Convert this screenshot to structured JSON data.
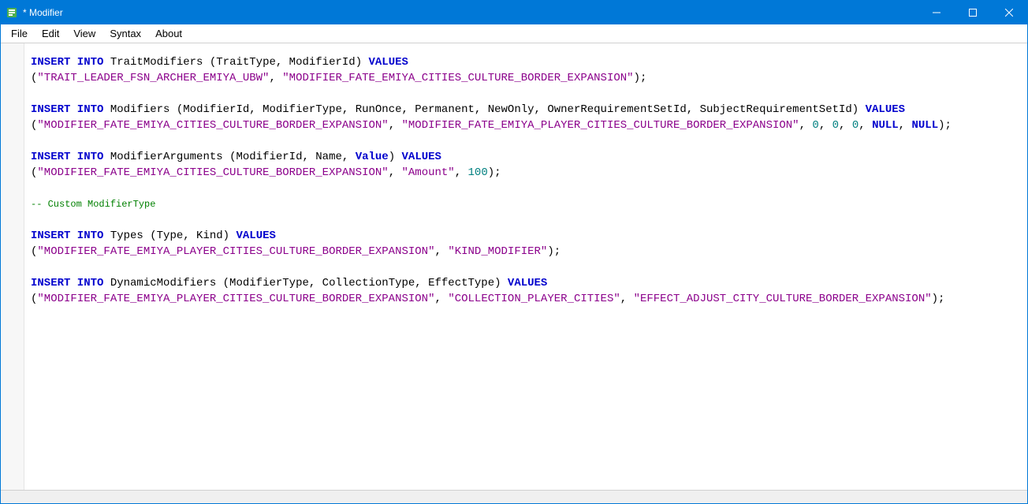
{
  "window": {
    "title": "* Modifier"
  },
  "menu": {
    "items": [
      "File",
      "Edit",
      "View",
      "Syntax",
      "About"
    ]
  },
  "sql": {
    "stmt1": {
      "kw1": "INSERT INTO",
      "tbl": "TraitModifiers",
      "cols": "(TraitType, ModifierId)",
      "kw2": "VALUES",
      "v1": "\"TRAIT_LEADER_FSN_ARCHER_EMIYA_UBW\"",
      "v2": "\"MODIFIER_FATE_EMIYA_CITIES_CULTURE_BORDER_EXPANSION\""
    },
    "stmt2": {
      "kw1": "INSERT INTO",
      "tbl": "Modifiers",
      "cols": "(ModifierId, ModifierType, RunOnce, Permanent, NewOnly, OwnerRequirementSetId, SubjectRequirementSetId)",
      "kw2": "VALUES",
      "v1": "\"MODIFIER_FATE_EMIYA_CITIES_CULTURE_BORDER_EXPANSION\"",
      "v2": "\"MODIFIER_FATE_EMIYA_PLAYER_CITIES_CULTURE_BORDER_EXPANSION\"",
      "n1": "0",
      "n2": "0",
      "n3": "0",
      "k1": "NULL",
      "k2": "NULL"
    },
    "stmt3": {
      "kw1": "INSERT INTO",
      "tbl": "ModifierArguments",
      "cols": "(ModifierId, Name,",
      "kw2a": "Value",
      "cols2": ")",
      "kw2": "VALUES",
      "v1": "\"MODIFIER_FATE_EMIYA_CITIES_CULTURE_BORDER_EXPANSION\"",
      "v2": "\"Amount\"",
      "n1": "100"
    },
    "comment": "-- Custom ModifierType",
    "stmt4": {
      "kw1": "INSERT INTO",
      "tbl": "Types",
      "cols": "(Type, Kind)",
      "kw2": "VALUES",
      "v1": "\"MODIFIER_FATE_EMIYA_PLAYER_CITIES_CULTURE_BORDER_EXPANSION\"",
      "v2": "\"KIND_MODIFIER\""
    },
    "stmt5": {
      "kw1": "INSERT INTO",
      "tbl": "DynamicModifiers",
      "cols": "(ModifierType, CollectionType, EffectType)",
      "kw2": "VALUES",
      "v1": "\"MODIFIER_FATE_EMIYA_PLAYER_CITIES_CULTURE_BORDER_EXPANSION\"",
      "v2": "\"COLLECTION_PLAYER_CITIES\"",
      "v3": "\"EFFECT_ADJUST_CITY_CULTURE_BORDER_EXPANSION\""
    }
  }
}
